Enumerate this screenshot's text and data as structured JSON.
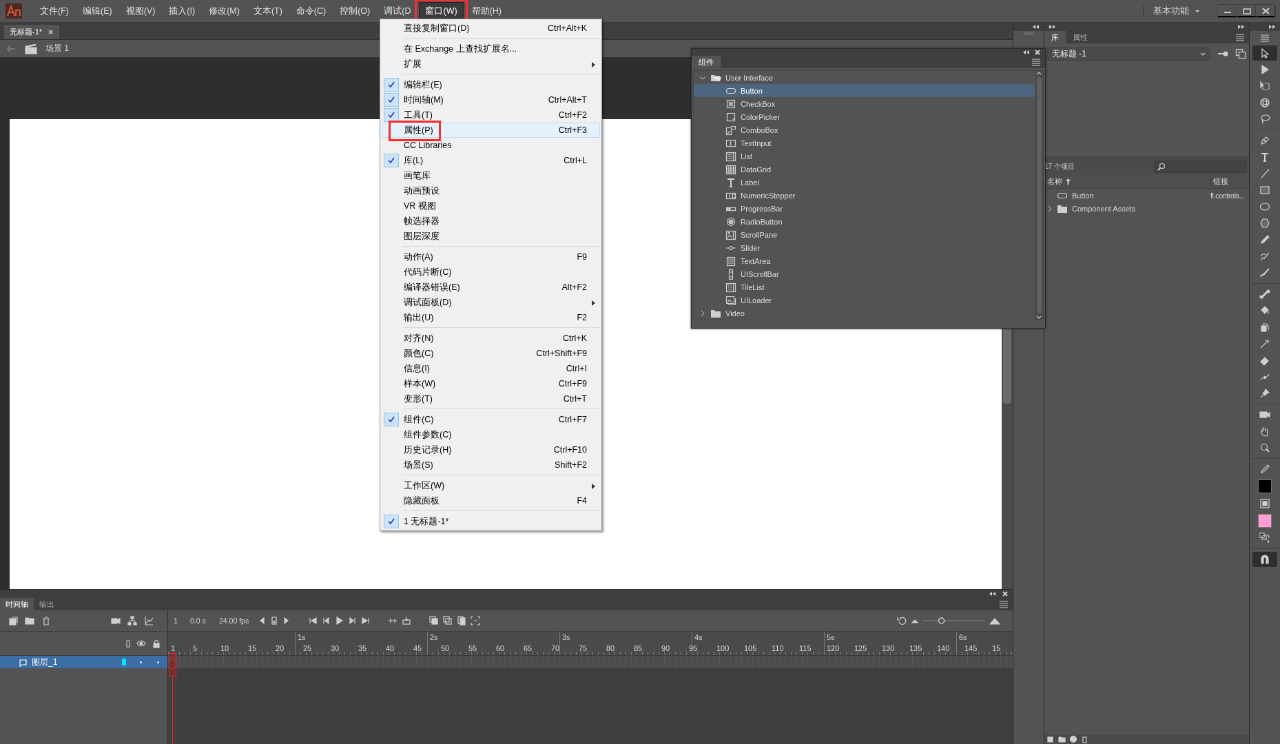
{
  "menubar": {
    "items": [
      {
        "label": "文件(F)",
        "open": false,
        "annotated": false
      },
      {
        "label": "编辑(E)",
        "open": false,
        "annotated": false
      },
      {
        "label": "视图(V)",
        "open": false,
        "annotated": false
      },
      {
        "label": "插入(I)",
        "open": false,
        "annotated": false
      },
      {
        "label": "修改(M)",
        "open": false,
        "annotated": false
      },
      {
        "label": "文本(T)",
        "open": false,
        "annotated": false
      },
      {
        "label": "命令(C)",
        "open": false,
        "annotated": false
      },
      {
        "label": "控制(O)",
        "open": false,
        "annotated": false
      },
      {
        "label": "调试(D",
        "open": false,
        "annotated": false
      },
      {
        "label": "窗口(W)",
        "open": true,
        "annotated": true
      },
      {
        "label": "帮助(H)",
        "open": false,
        "annotated": false
      }
    ],
    "workspace": "基本功能"
  },
  "document_tab": {
    "title": "无标题-1*"
  },
  "scene": {
    "label": "场景 1"
  },
  "menu": {
    "items": [
      {
        "kind": "item",
        "label": "直接复制窗口(D)",
        "shortcut": "Ctrl+Alt+K",
        "checked": false,
        "submenu": false,
        "selected": false,
        "annotated": false
      },
      {
        "kind": "separator"
      },
      {
        "kind": "item",
        "label": "在 Exchange 上查找扩展名...",
        "checked": false,
        "submenu": false,
        "selected": false,
        "annotated": false
      },
      {
        "kind": "item",
        "label": "扩展",
        "checked": false,
        "submenu": true,
        "selected": false,
        "annotated": false
      },
      {
        "kind": "separator"
      },
      {
        "kind": "item",
        "label": "编辑栏(E)",
        "checked": true,
        "submenu": false,
        "selected": false,
        "annotated": false
      },
      {
        "kind": "item",
        "label": "时间轴(M)",
        "shortcut": "Ctrl+Alt+T",
        "checked": true,
        "submenu": false,
        "selected": false,
        "annotated": false
      },
      {
        "kind": "item",
        "label": "工具(T)",
        "shortcut": "Ctrl+F2",
        "checked": true,
        "submenu": false,
        "selected": false,
        "annotated": false
      },
      {
        "kind": "item",
        "label": "属性(P)",
        "shortcut": "Ctrl+F3",
        "checked": false,
        "submenu": false,
        "selected": true,
        "annotated": true
      },
      {
        "kind": "item",
        "label": "CC Libraries",
        "checked": false,
        "submenu": false,
        "selected": false,
        "annotated": false
      },
      {
        "kind": "item",
        "label": "库(L)",
        "shortcut": "Ctrl+L",
        "checked": true,
        "submenu": false,
        "selected": false,
        "annotated": false
      },
      {
        "kind": "item",
        "label": "画笔库",
        "checked": false,
        "submenu": false,
        "selected": false,
        "annotated": false
      },
      {
        "kind": "item",
        "label": "动画预设",
        "checked": false,
        "submenu": false,
        "selected": false,
        "annotated": false
      },
      {
        "kind": "item",
        "label": "VR 视图",
        "checked": false,
        "submenu": false,
        "selected": false,
        "annotated": false
      },
      {
        "kind": "item",
        "label": "帧选择器",
        "checked": false,
        "submenu": false,
        "selected": false,
        "annotated": false
      },
      {
        "kind": "item",
        "label": "图层深度",
        "checked": false,
        "submenu": false,
        "selected": false,
        "annotated": false
      },
      {
        "kind": "separator"
      },
      {
        "kind": "item",
        "label": "动作(A)",
        "shortcut": "F9",
        "checked": false,
        "submenu": false,
        "selected": false,
        "annotated": false
      },
      {
        "kind": "item",
        "label": "代码片断(C)",
        "checked": false,
        "submenu": false,
        "selected": false,
        "annotated": false
      },
      {
        "kind": "item",
        "label": "编译器错误(E)",
        "shortcut": "Alt+F2",
        "checked": false,
        "submenu": false,
        "selected": false,
        "annotated": false
      },
      {
        "kind": "item",
        "label": "调试面板(D)",
        "checked": false,
        "submenu": true,
        "selected": false,
        "annotated": false
      },
      {
        "kind": "item",
        "label": "输出(U)",
        "shortcut": "F2",
        "checked": false,
        "submenu": false,
        "selected": false,
        "annotated": false
      },
      {
        "kind": "separator"
      },
      {
        "kind": "item",
        "label": "对齐(N)",
        "shortcut": "Ctrl+K",
        "checked": false,
        "submenu": false,
        "selected": false,
        "annotated": false
      },
      {
        "kind": "item",
        "label": "颜色(C)",
        "shortcut": "Ctrl+Shift+F9",
        "checked": false,
        "submenu": false,
        "selected": false,
        "annotated": false
      },
      {
        "kind": "item",
        "label": "信息(I)",
        "shortcut": "Ctrl+I",
        "checked": false,
        "submenu": false,
        "selected": false,
        "annotated": false
      },
      {
        "kind": "item",
        "label": "样本(W)",
        "shortcut": "Ctrl+F9",
        "checked": false,
        "submenu": false,
        "selected": false,
        "annotated": false
      },
      {
        "kind": "item",
        "label": "变形(T)",
        "shortcut": "Ctrl+T",
        "checked": false,
        "submenu": false,
        "selected": false,
        "annotated": false
      },
      {
        "kind": "separator"
      },
      {
        "kind": "item",
        "label": "组件(C)",
        "shortcut": "Ctrl+F7",
        "checked": true,
        "submenu": false,
        "selected": false,
        "annotated": false
      },
      {
        "kind": "item",
        "label": "组件参数(C)",
        "checked": false,
        "submenu": false,
        "selected": false,
        "annotated": false
      },
      {
        "kind": "item",
        "label": "历史记录(H)",
        "shortcut": "Ctrl+F10",
        "checked": false,
        "submenu": false,
        "selected": false,
        "annotated": false
      },
      {
        "kind": "item",
        "label": "场景(S)",
        "shortcut": "Shift+F2",
        "checked": false,
        "submenu": false,
        "selected": false,
        "annotated": false
      },
      {
        "kind": "separator"
      },
      {
        "kind": "item",
        "label": "工作区(W)",
        "checked": false,
        "submenu": true,
        "selected": false,
        "annotated": false
      },
      {
        "kind": "item",
        "label": "隐藏面板",
        "shortcut": "F4",
        "checked": false,
        "submenu": false,
        "selected": false,
        "annotated": false
      },
      {
        "kind": "separator"
      },
      {
        "kind": "item",
        "label": "1 无标题-1*",
        "checked": true,
        "submenu": false,
        "selected": false,
        "annotated": false
      }
    ]
  },
  "components_panel": {
    "tab": "组件",
    "tree": [
      {
        "label": "User Interface",
        "expanded": true,
        "selected": false,
        "children": [
          {
            "label": "Button",
            "kind": "button",
            "selected": true
          },
          {
            "label": "CheckBox",
            "kind": "checkbox",
            "selected": false
          },
          {
            "label": "ColorPicker",
            "kind": "colorpicker",
            "selected": false
          },
          {
            "label": "ComboBox",
            "kind": "combobox",
            "selected": false
          },
          {
            "label": "TextInput",
            "kind": "textinput",
            "selected": false
          },
          {
            "label": "List",
            "kind": "list",
            "selected": false
          },
          {
            "label": "DataGrid",
            "kind": "datagrid",
            "selected": false
          },
          {
            "label": "Label",
            "kind": "label",
            "selected": false
          },
          {
            "label": "NumericStepper",
            "kind": "stepper",
            "selected": false
          },
          {
            "label": "ProgressBar",
            "kind": "progressbar",
            "selected": false
          },
          {
            "label": "RadioButton",
            "kind": "radio",
            "selected": false
          },
          {
            "label": "ScrollPane",
            "kind": "scrollpane",
            "selected": false
          },
          {
            "label": "Slider",
            "kind": "slider",
            "selected": false
          },
          {
            "label": "TextArea",
            "kind": "textarea",
            "selected": false
          },
          {
            "label": "UIScrollBar",
            "kind": "scrollbar",
            "selected": false
          },
          {
            "label": "TileList",
            "kind": "tilelist",
            "selected": false
          },
          {
            "label": "UILoader",
            "kind": "loader",
            "selected": false
          }
        ]
      },
      {
        "label": "Video",
        "expanded": false,
        "selected": false
      }
    ]
  },
  "library_panel": {
    "tabs": [
      {
        "label": "库",
        "selected": true
      },
      {
        "label": "属性",
        "selected": false
      }
    ],
    "document": "无标题 -1",
    "count": "17 个项目",
    "columns": [
      {
        "label": "名称",
        "sorted": true
      },
      {
        "label": "链接",
        "sorted": false
      }
    ],
    "items": [
      {
        "kind": "symbol",
        "name": "Button",
        "linkage": "fl.controls..."
      },
      {
        "kind": "folder",
        "name": "Component Assets",
        "expanded": false
      }
    ]
  },
  "timeline": {
    "tabs": [
      {
        "label": "时间轴",
        "selected": true
      },
      {
        "label": "输出",
        "selected": false
      }
    ],
    "frame": "1",
    "time": "0.0 s",
    "fps": "24.00 fps",
    "seconds": [
      "1s",
      "2s",
      "3s",
      "4s",
      "5s",
      "6s"
    ],
    "frame_numbers": [
      "1",
      "5",
      "10",
      "15",
      "20",
      "25",
      "30",
      "35",
      "40",
      "45",
      "50",
      "55",
      "60",
      "65",
      "70",
      "75",
      "80",
      "85",
      "90",
      "95",
      "100",
      "105",
      "110",
      "115",
      "120",
      "125",
      "130",
      "135",
      "140",
      "145",
      "15"
    ],
    "layers": [
      {
        "name": "图层_1",
        "selected": true,
        "color": "#00e5ff"
      }
    ],
    "zoom": {
      "level": 0.27
    }
  },
  "tools": [
    {
      "kind": "select",
      "selected": true
    },
    {
      "kind": "subselect",
      "selected": false
    },
    {
      "kind": "transform",
      "selected": false
    },
    {
      "kind": "rotate3d",
      "selected": false
    },
    {
      "kind": "lasso",
      "selected": false
    },
    {
      "kind": "separator"
    },
    {
      "kind": "pen",
      "selected": false
    },
    {
      "kind": "text",
      "selected": false
    },
    {
      "kind": "line",
      "selected": false
    },
    {
      "kind": "rect",
      "selected": false
    },
    {
      "kind": "oval",
      "selected": false
    },
    {
      "kind": "polygon",
      "selected": false
    },
    {
      "kind": "pencil",
      "selected": false
    },
    {
      "kind": "brush",
      "selected": false
    },
    {
      "kind": "paintbrush",
      "selected": false
    },
    {
      "kind": "separator"
    },
    {
      "kind": "bone",
      "selected": false
    },
    {
      "kind": "bucket",
      "selected": false
    },
    {
      "kind": "ink",
      "selected": false
    },
    {
      "kind": "eyedropper",
      "selected": false
    },
    {
      "kind": "eraser",
      "selected": false
    },
    {
      "kind": "width",
      "selected": false
    },
    {
      "kind": "pin",
      "selected": false
    },
    {
      "kind": "separator"
    },
    {
      "kind": "camera",
      "selected": false
    },
    {
      "kind": "hand",
      "selected": false
    },
    {
      "kind": "zoom",
      "selected": false
    },
    {
      "kind": "separator"
    },
    {
      "kind": "strokepen",
      "selected": false
    },
    {
      "kind": "swatch",
      "color": "#000000"
    },
    {
      "kind": "fillicon",
      "selected": false
    },
    {
      "kind": "swatch",
      "color": "#ff9ed2"
    },
    {
      "kind": "swap",
      "selected": false
    },
    {
      "kind": "separator"
    },
    {
      "kind": "snap",
      "selected": true
    }
  ]
}
